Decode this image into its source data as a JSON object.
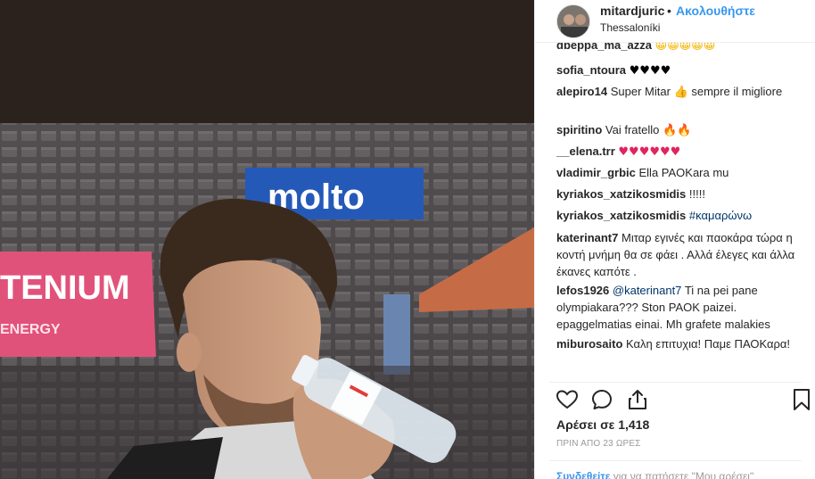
{
  "post": {
    "username": "mitardjuric",
    "separator": "•",
    "follow_label": "Ακολουθήστε",
    "location": "Thessaloníki"
  },
  "photo": {
    "banner_left": "TENIUM",
    "banner_left_sub": "ENERGY",
    "banner_right": "molto"
  },
  "comments": [
    {
      "user": "dbeppa_ma_azza",
      "text": "",
      "emoji": "😀😀😀😀😀"
    },
    {
      "user": "sofia_ntoura",
      "text": "",
      "emoji": "♥♥♥♥"
    },
    {
      "user": "alepiro14",
      "text": "Super Mitar",
      "emoji": "👍",
      "text2": "sempre il migliore"
    },
    {
      "user": "spiritino",
      "text": "Vai fratello",
      "emoji": "🔥🔥"
    },
    {
      "user": "__elena.trr",
      "text": "",
      "emoji": "♥♥♥♥♥♥"
    },
    {
      "user": "vladimir_grbic",
      "text": "Ella PAOKara mu"
    },
    {
      "user": "kyriakos_xatzikosmidis",
      "text": "!!!!!"
    },
    {
      "user": "kyriakos_xatzikosmidis",
      "hashtag": "#καμαρώνω"
    },
    {
      "user": "katerinant7",
      "text": "Μιταρ εγινές και παοκάρα τώρα η κοντή μνήμη θα σε φάει . Αλλά έλεγες και άλλα έκανες καπότε ."
    },
    {
      "user": "lefos1926",
      "mention": "@katerinant7",
      "text": "Ti na pei pane olympiakara??? Ston PAOK paizei. epaggelmatias einai. Mh grafete malakies"
    },
    {
      "user": "miburosaito",
      "text": "Καλη επιτυχια! Παμε ΠΑΟΚαρα!"
    }
  ],
  "actions": {
    "like_icon": "heart-outline-icon",
    "comment_icon": "comment-bubble-icon",
    "share_icon": "share-upload-icon",
    "save_icon": "bookmark-icon"
  },
  "likes_text": "Αρέσει σε 1,418",
  "timestamp": "ΠΡΙΝ ΑΠΟ 23 ΩΡΕΣ",
  "footer": {
    "login": "Συνδεθείτε",
    "rest": "για να πατήσετε \"Μου αρέσει\""
  },
  "colors": {
    "link_blue": "#3897f0",
    "mention_blue": "#003569",
    "heart_red": "#e0245e",
    "text": "#262626",
    "muted": "#999999"
  }
}
